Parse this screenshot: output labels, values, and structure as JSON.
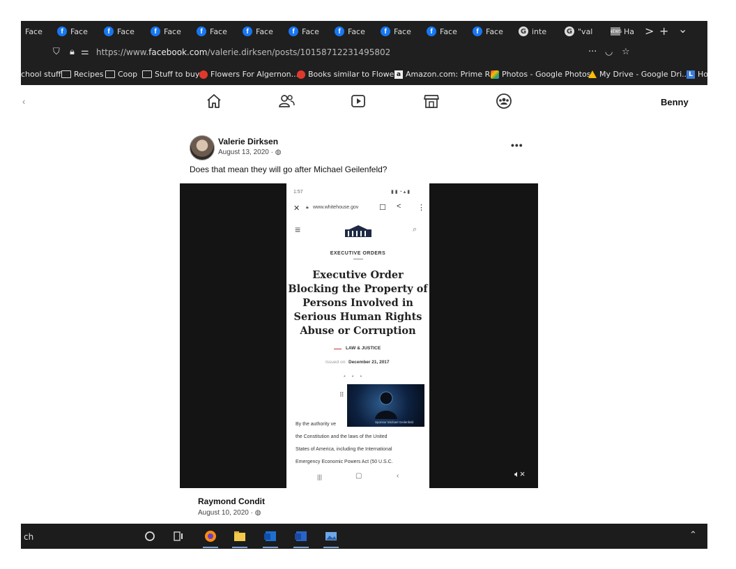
{
  "browser": {
    "tabs": [
      {
        "label": "Face",
        "icon": "facebook-icon"
      },
      {
        "label": "Face",
        "icon": "facebook-icon"
      },
      {
        "label": "Face",
        "icon": "facebook-icon"
      },
      {
        "label": "Face",
        "icon": "facebook-icon"
      },
      {
        "label": "Face",
        "icon": "facebook-icon"
      },
      {
        "label": "Face",
        "icon": "facebook-icon"
      },
      {
        "label": "Face",
        "icon": "facebook-icon"
      },
      {
        "label": "Face",
        "icon": "facebook-icon"
      },
      {
        "label": "Face",
        "icon": "facebook-icon"
      },
      {
        "label": "Face",
        "icon": "facebook-icon"
      },
      {
        "label": "Face",
        "icon": "facebook-icon"
      },
      {
        "label": "inte",
        "icon": "google-icon"
      },
      {
        "label": "\"val",
        "icon": "google-icon"
      },
      {
        "label": "Ha",
        "icon": "news-icon"
      }
    ],
    "tab_controls": {
      "scroll": ">",
      "new_tab": "+",
      "list": "⌄"
    },
    "url_prefix": "https://www.",
    "url_domain": "facebook.com",
    "url_path": "/valerie.dirksen/posts/10158712231495802",
    "url_more": "···",
    "bookmarks": [
      {
        "label": "chool stuff",
        "icon": "folder-icon"
      },
      {
        "label": "Recipes",
        "icon": "folder-icon"
      },
      {
        "label": "Coop",
        "icon": "folder-icon"
      },
      {
        "label": "Stuff to buy",
        "icon": "folder-icon"
      },
      {
        "label": "Flowers For Algernon....",
        "icon": "reddit-icon"
      },
      {
        "label": "Books similar to Flowe...",
        "icon": "reddit-icon"
      },
      {
        "label": "Amazon.com: Prime R...",
        "icon": "amazon-icon"
      },
      {
        "label": "Photos - Google Photos",
        "icon": "google-photos-icon"
      },
      {
        "label": "My Drive - Google Dri...",
        "icon": "google-drive-icon"
      },
      {
        "label": "Ho",
        "icon": "bookmark-l-icon"
      }
    ]
  },
  "facebook": {
    "back": "‹",
    "user_name": "Benny"
  },
  "post": {
    "author": "Valerie Dirksen",
    "date": "August 13, 2020 · ",
    "text": "Does that mean they will go after Michael Geilenfeld?",
    "more": "•••"
  },
  "screenshot": {
    "status_time": "1:57",
    "url": "www.whitehouse.gov",
    "section": "EXECUTIVE ORDERS",
    "title": "Executive Order Blocking the Property of Persons Involved in Serious Human Rights Abuse or Corruption",
    "category": "LAW & JUSTICE",
    "issued_prefix": "Issued on:",
    "issued_date": "December 21, 2017",
    "body_lines": [
      "By the authority ve",
      "the Constitution and the laws of the United",
      "States of America, including the International",
      "Emergency Economic Powers Act (50 U.S.C."
    ],
    "video_caption": "Sponsor Michael Geilenfeld"
  },
  "comment": {
    "author": "Raymond Condit",
    "date": "August 10, 2020 · "
  },
  "taskbar": {
    "search": "ch"
  },
  "colors": {
    "facebook_blue": "#1877f2",
    "chrome_dark": "#1f1f1f",
    "media_dark": "#141414",
    "accent_red": "#c0392b"
  }
}
